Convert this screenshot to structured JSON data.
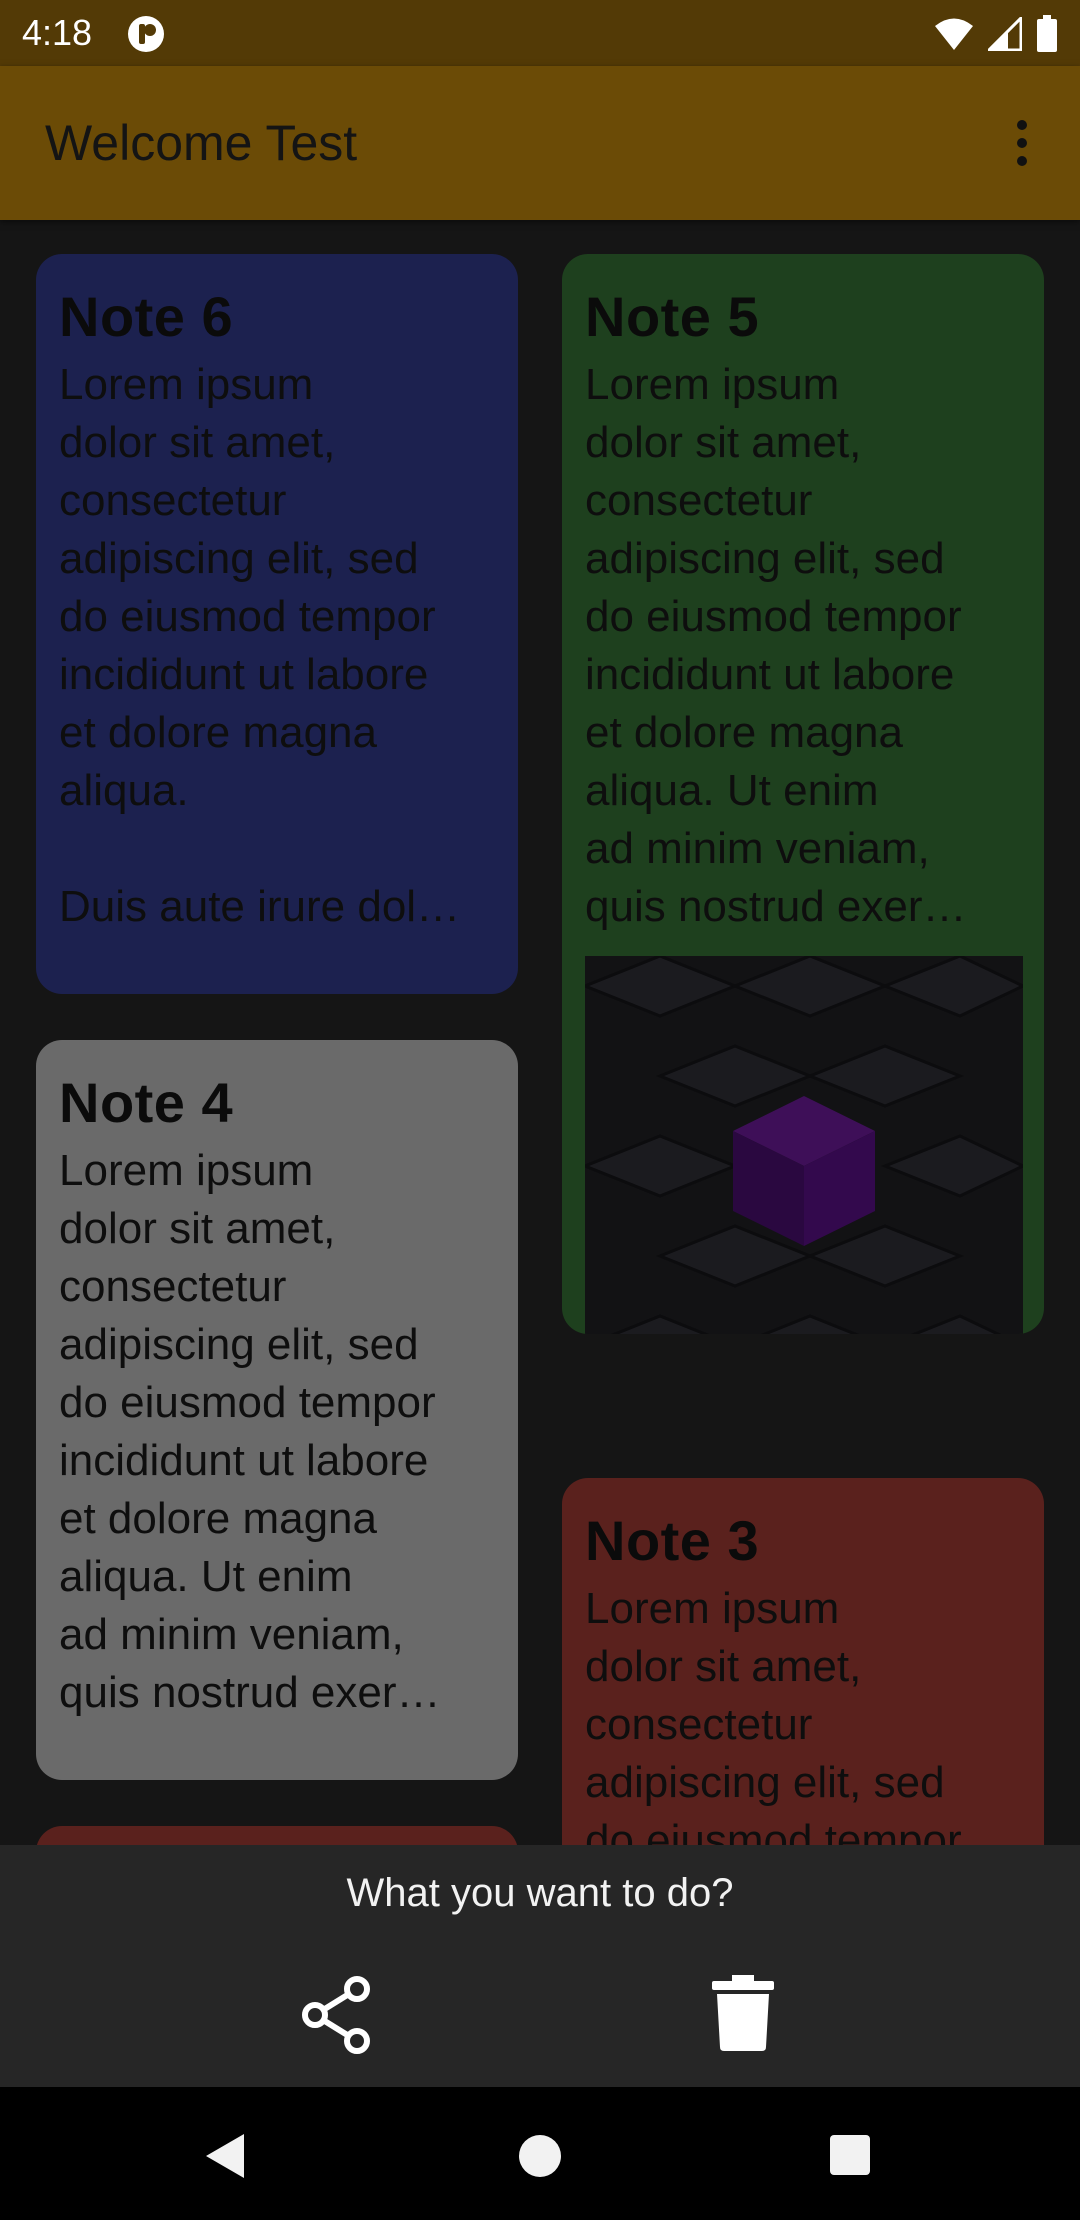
{
  "status_bar": {
    "time": "4:18"
  },
  "app_bar": {
    "title": "Welcome Test"
  },
  "notes": [
    {
      "title": "Note 6",
      "body": "Lorem ipsum\ndolor sit amet,\nconsectetur\nadipiscing elit, sed\ndo eiusmod tempor\nincididunt ut labore\net dolore magna\naliqua.\n\nDuis aute irure dol…",
      "color": "#1c214f"
    },
    {
      "title": "Note 5",
      "body": "Lorem ipsum\ndolor sit amet,\nconsectetur\nadipiscing elit, sed\ndo eiusmod tempor\nincididunt ut labore\net dolore magna\naliqua. Ut enim\nad minim veniam,\nquis nostrud exer…",
      "color": "#1e401e",
      "has_image": true
    },
    {
      "title": "Note 4",
      "body": "Lorem ipsum\ndolor sit amet,\nconsectetur\nadipiscing elit, sed\ndo eiusmod tempor\nincididunt ut labore\net dolore magna\naliqua. Ut enim\nad minim veniam,\nquis nostrud exer…",
      "color": "#6a6a6a"
    },
    {
      "title": "Note 3",
      "body": "Lorem ipsum\ndolor sit amet,\nconsectetur\nadipiscing elit, sed\ndo eiusmod tempor",
      "color": "#5a211d"
    }
  ],
  "bottom_sheet": {
    "prompt": "What you want to do?",
    "actions": [
      {
        "icon": "share-icon"
      },
      {
        "icon": "delete-icon"
      }
    ]
  },
  "colors": {
    "status_bar": "#533a06",
    "app_bar": "#6b4b06",
    "background": "#151515",
    "sheet": "#262626"
  }
}
